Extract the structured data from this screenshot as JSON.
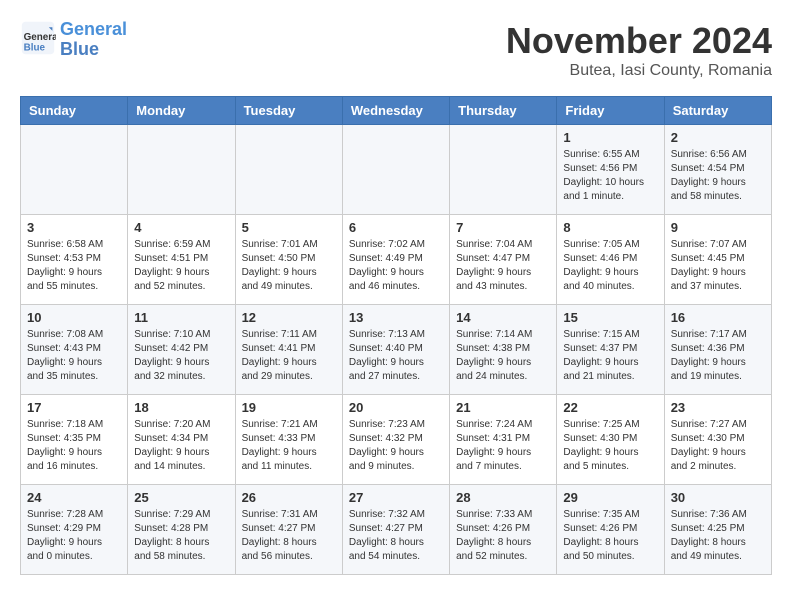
{
  "header": {
    "logo_line1": "General",
    "logo_line2": "Blue",
    "month": "November 2024",
    "location": "Butea, Iasi County, Romania"
  },
  "weekdays": [
    "Sunday",
    "Monday",
    "Tuesday",
    "Wednesday",
    "Thursday",
    "Friday",
    "Saturday"
  ],
  "weeks": [
    [
      {
        "day": "",
        "info": ""
      },
      {
        "day": "",
        "info": ""
      },
      {
        "day": "",
        "info": ""
      },
      {
        "day": "",
        "info": ""
      },
      {
        "day": "",
        "info": ""
      },
      {
        "day": "1",
        "info": "Sunrise: 6:55 AM\nSunset: 4:56 PM\nDaylight: 10 hours\nand 1 minute."
      },
      {
        "day": "2",
        "info": "Sunrise: 6:56 AM\nSunset: 4:54 PM\nDaylight: 9 hours\nand 58 minutes."
      }
    ],
    [
      {
        "day": "3",
        "info": "Sunrise: 6:58 AM\nSunset: 4:53 PM\nDaylight: 9 hours\nand 55 minutes."
      },
      {
        "day": "4",
        "info": "Sunrise: 6:59 AM\nSunset: 4:51 PM\nDaylight: 9 hours\nand 52 minutes."
      },
      {
        "day": "5",
        "info": "Sunrise: 7:01 AM\nSunset: 4:50 PM\nDaylight: 9 hours\nand 49 minutes."
      },
      {
        "day": "6",
        "info": "Sunrise: 7:02 AM\nSunset: 4:49 PM\nDaylight: 9 hours\nand 46 minutes."
      },
      {
        "day": "7",
        "info": "Sunrise: 7:04 AM\nSunset: 4:47 PM\nDaylight: 9 hours\nand 43 minutes."
      },
      {
        "day": "8",
        "info": "Sunrise: 7:05 AM\nSunset: 4:46 PM\nDaylight: 9 hours\nand 40 minutes."
      },
      {
        "day": "9",
        "info": "Sunrise: 7:07 AM\nSunset: 4:45 PM\nDaylight: 9 hours\nand 37 minutes."
      }
    ],
    [
      {
        "day": "10",
        "info": "Sunrise: 7:08 AM\nSunset: 4:43 PM\nDaylight: 9 hours\nand 35 minutes."
      },
      {
        "day": "11",
        "info": "Sunrise: 7:10 AM\nSunset: 4:42 PM\nDaylight: 9 hours\nand 32 minutes."
      },
      {
        "day": "12",
        "info": "Sunrise: 7:11 AM\nSunset: 4:41 PM\nDaylight: 9 hours\nand 29 minutes."
      },
      {
        "day": "13",
        "info": "Sunrise: 7:13 AM\nSunset: 4:40 PM\nDaylight: 9 hours\nand 27 minutes."
      },
      {
        "day": "14",
        "info": "Sunrise: 7:14 AM\nSunset: 4:38 PM\nDaylight: 9 hours\nand 24 minutes."
      },
      {
        "day": "15",
        "info": "Sunrise: 7:15 AM\nSunset: 4:37 PM\nDaylight: 9 hours\nand 21 minutes."
      },
      {
        "day": "16",
        "info": "Sunrise: 7:17 AM\nSunset: 4:36 PM\nDaylight: 9 hours\nand 19 minutes."
      }
    ],
    [
      {
        "day": "17",
        "info": "Sunrise: 7:18 AM\nSunset: 4:35 PM\nDaylight: 9 hours\nand 16 minutes."
      },
      {
        "day": "18",
        "info": "Sunrise: 7:20 AM\nSunset: 4:34 PM\nDaylight: 9 hours\nand 14 minutes."
      },
      {
        "day": "19",
        "info": "Sunrise: 7:21 AM\nSunset: 4:33 PM\nDaylight: 9 hours\nand 11 minutes."
      },
      {
        "day": "20",
        "info": "Sunrise: 7:23 AM\nSunset: 4:32 PM\nDaylight: 9 hours\nand 9 minutes."
      },
      {
        "day": "21",
        "info": "Sunrise: 7:24 AM\nSunset: 4:31 PM\nDaylight: 9 hours\nand 7 minutes."
      },
      {
        "day": "22",
        "info": "Sunrise: 7:25 AM\nSunset: 4:30 PM\nDaylight: 9 hours\nand 5 minutes."
      },
      {
        "day": "23",
        "info": "Sunrise: 7:27 AM\nSunset: 4:30 PM\nDaylight: 9 hours\nand 2 minutes."
      }
    ],
    [
      {
        "day": "24",
        "info": "Sunrise: 7:28 AM\nSunset: 4:29 PM\nDaylight: 9 hours\nand 0 minutes."
      },
      {
        "day": "25",
        "info": "Sunrise: 7:29 AM\nSunset: 4:28 PM\nDaylight: 8 hours\nand 58 minutes."
      },
      {
        "day": "26",
        "info": "Sunrise: 7:31 AM\nSunset: 4:27 PM\nDaylight: 8 hours\nand 56 minutes."
      },
      {
        "day": "27",
        "info": "Sunrise: 7:32 AM\nSunset: 4:27 PM\nDaylight: 8 hours\nand 54 minutes."
      },
      {
        "day": "28",
        "info": "Sunrise: 7:33 AM\nSunset: 4:26 PM\nDaylight: 8 hours\nand 52 minutes."
      },
      {
        "day": "29",
        "info": "Sunrise: 7:35 AM\nSunset: 4:26 PM\nDaylight: 8 hours\nand 50 minutes."
      },
      {
        "day": "30",
        "info": "Sunrise: 7:36 AM\nSunset: 4:25 PM\nDaylight: 8 hours\nand 49 minutes."
      }
    ]
  ]
}
